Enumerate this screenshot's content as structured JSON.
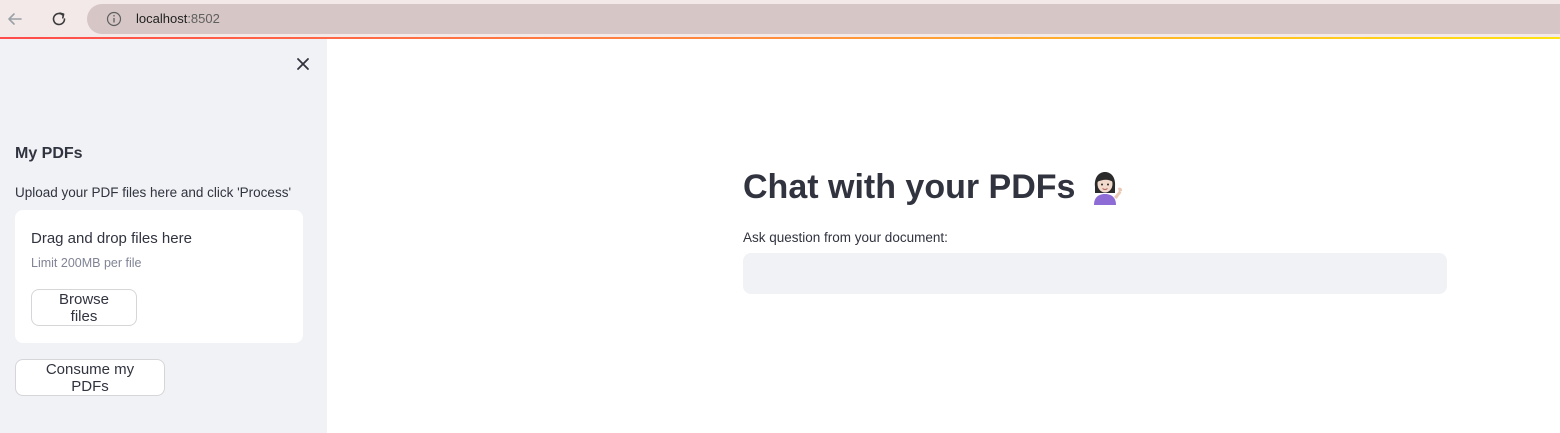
{
  "browser": {
    "url_host": "localhost",
    "url_port": ":8502"
  },
  "sidebar": {
    "title": "My PDFs",
    "caption": "Upload your PDF files here and click 'Process'",
    "uploader": {
      "title": "Drag and drop files here",
      "limit": "Limit 200MB per file",
      "browse_label": "Browse files"
    },
    "consume_label": "Consume my PDFs"
  },
  "main": {
    "title": "Chat with your PDFs",
    "title_icon": "woman-tipping-hand-icon",
    "question_label": "Ask question from your document:",
    "question_value": ""
  },
  "colors": {
    "accent": "#ff4b4b",
    "sidebar_bg": "#f0f2f6",
    "text": "#31333f"
  }
}
